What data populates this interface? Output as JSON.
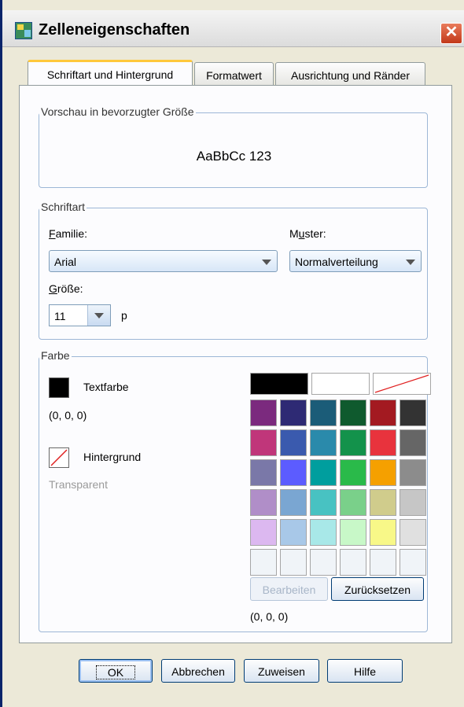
{
  "window": {
    "title": "Zelleneigenschaften",
    "close_glyph": "✕"
  },
  "tabs": [
    {
      "label": "Schriftart und Hintergrund",
      "active": true
    },
    {
      "label": "Formatwert",
      "active": false
    },
    {
      "label": "Ausrichtung und Ränder",
      "active": false
    }
  ],
  "preview": {
    "legend": "Vorschau in bevorzugter Größe",
    "sample_text": "AaBbCc 123"
  },
  "font": {
    "legend": "Schriftart",
    "family_label": "Familie:",
    "family_value": "Arial",
    "style_label": "Muster:",
    "style_value": "Normalverteilung",
    "size_label": "Größe:",
    "size_value": "11",
    "size_unit": "p"
  },
  "color": {
    "legend": "Farbe",
    "text_color_label": "Textfarbe",
    "text_color_value": "(0, 0, 0)",
    "text_color_hex": "#000000",
    "background_label": "Hintergrund",
    "background_value": "Transparent",
    "palette_top": [
      "#000000",
      "#ffffff",
      "none"
    ],
    "palette": [
      [
        "#7b2a7e",
        "#2e2a74",
        "#1b5c78",
        "#0f5a2e",
        "#a31a21",
        "#333333"
      ],
      [
        "#c0367a",
        "#3a5aae",
        "#2a8aab",
        "#13924b",
        "#e8333d",
        "#666666"
      ],
      [
        "#7a78a8",
        "#5c5cff",
        "#009e9e",
        "#2aba4a",
        "#f5a000",
        "#8c8c8c"
      ],
      [
        "#b08ec8",
        "#7aa6d2",
        "#48c2c2",
        "#7ad08a",
        "#d0cc8c",
        "#c6c6c6"
      ],
      [
        "#dcb8f0",
        "#a8c8e8",
        "#a8e8e8",
        "#c8f8c8",
        "#f8f888",
        "#e0e0e0"
      ],
      [
        "#f0f4f8",
        "#f0f4f8",
        "#f0f4f8",
        "#f0f4f8",
        "#f0f4f8",
        "#f0f4f8"
      ]
    ],
    "edit_button": "Bearbeiten",
    "reset_button": "Zurücksetzen",
    "selected_value": "(0, 0, 0)"
  },
  "footer": {
    "ok": "OK",
    "cancel": "Abbrechen",
    "apply": "Zuweisen",
    "help": "Hilfe"
  }
}
